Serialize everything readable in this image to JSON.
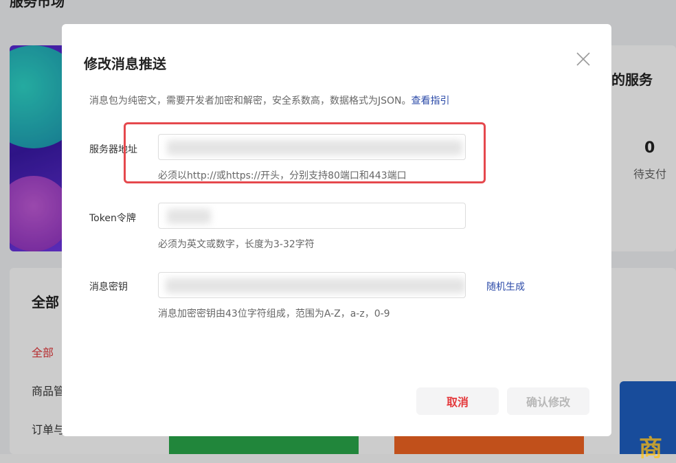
{
  "background": {
    "page_title": "服务市场",
    "service_title": "的服务",
    "pending_count": "0",
    "pending_label": "待支付",
    "categories_title": "全部",
    "categories": [
      "全部",
      "商品管",
      "订单与"
    ],
    "product_badge": "商"
  },
  "modal": {
    "title": "修改消息推送",
    "description": "消息包为纯密文，需要开发者加密和解密，安全系数高，数据格式为JSON。",
    "guide_link": "查看指引",
    "fields": [
      {
        "label": "服务器地址",
        "value": "",
        "hint": "必须以http://或https://开头，分别支持80端口和443端口"
      },
      {
        "label": "Token令牌",
        "value": "",
        "hint": "必须为英文或数字，长度为3-32字符"
      },
      {
        "label": "消息密钥",
        "value": "",
        "hint": "消息加密密钥由43位字符组成，范围为A-Z，a-z，0-9"
      }
    ],
    "random_generate": "随机生成",
    "cancel_label": "取消",
    "confirm_label": "确认修改"
  },
  "colors": {
    "accent_red": "#e4393c",
    "link_blue": "#2b4aa8",
    "highlight_border": "#e5484d"
  }
}
